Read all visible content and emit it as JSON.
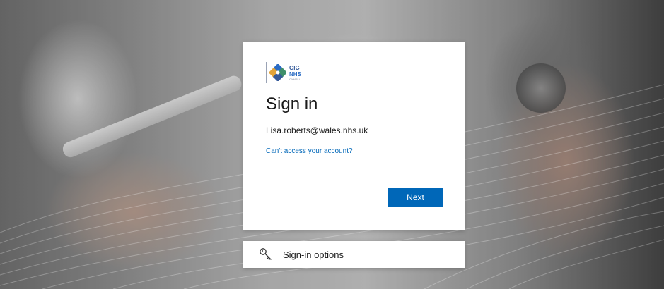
{
  "logo": {
    "line1": "GIG",
    "line2": "NHS",
    "tagline": "CYMRU"
  },
  "signin": {
    "title": "Sign in",
    "email_value": "Lisa.roberts@wales.nhs.uk",
    "cant_access_link": "Can't access your account?",
    "next_label": "Next"
  },
  "options": {
    "label": "Sign-in options",
    "icon": "key-icon"
  },
  "colors": {
    "primary_button": "#0067b8",
    "link": "#0067b8",
    "text": "#1b1b1b"
  }
}
